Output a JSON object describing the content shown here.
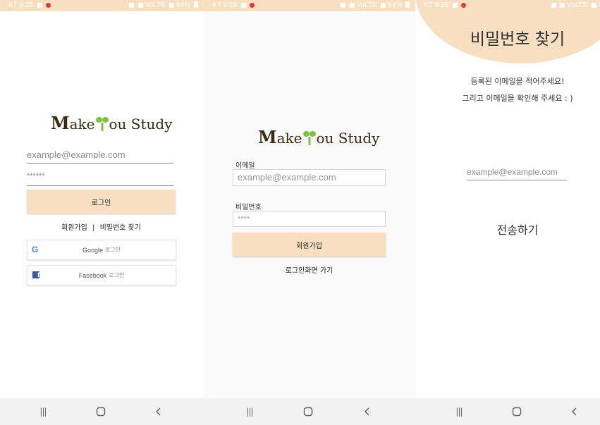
{
  "status": {
    "carrier": "KT",
    "time": "9:25",
    "signal_text": "VoLTE",
    "battery": "84%"
  },
  "logo": {
    "part1": "ake",
    "part2": "ou Study",
    "letter_m": "M"
  },
  "login": {
    "email_placeholder": "example@example.com",
    "password_placeholder": "******",
    "login_button": "로그인",
    "signup_link": "회원가입",
    "separator": "|",
    "find_password_link": "비밀번호 찾기",
    "google_button": "Google",
    "google_suffix": "로그인",
    "facebook_button": "Facebook",
    "facebook_suffix": "로그인"
  },
  "signup": {
    "email_label": "이메일",
    "email_placeholder": "example@example.com",
    "password_label": "비밀번호",
    "password_placeholder": "****",
    "signup_button": "회원가입",
    "back_to_login": "로그인화면 가기"
  },
  "find_password": {
    "title": "비밀번호 찾기",
    "instruction_line1": "등록된 이메일을 적어주세요!",
    "instruction_line2": "그리고 이메일을 확인해 주세요 : )",
    "email_placeholder": "example@example.com",
    "send_button": "전송하기"
  },
  "colors": {
    "accent_peach": "#f8dfc2",
    "status_bar": "#f7dfbf",
    "logo_brown": "#3b2a18",
    "sprout_green": "#7dc242",
    "google_blue": "#4285f4",
    "facebook_blue": "#3b5998"
  },
  "icons": {
    "nav_recents": "recents-icon",
    "nav_home": "home-icon",
    "nav_back": "back-icon"
  }
}
